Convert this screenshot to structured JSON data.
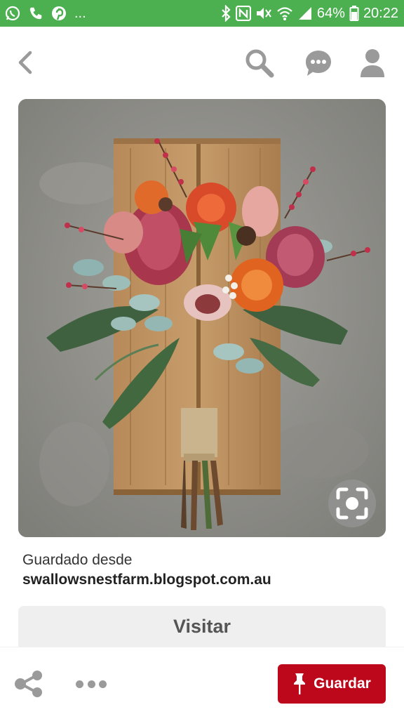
{
  "status_bar": {
    "battery": "64%",
    "time": "20:22",
    "ellipsis": "...",
    "left_icons": [
      "whatsapp-icon",
      "phone-icon",
      "pinterest-icon"
    ],
    "right_icons": [
      "bluetooth-icon",
      "nfc-icon",
      "mute-icon",
      "wifi-icon",
      "signal-icon",
      "battery-icon"
    ]
  },
  "nav": {
    "icons": [
      "back-icon",
      "search-icon",
      "chat-icon",
      "profile-icon"
    ]
  },
  "pin": {
    "image_icon": "visual-search-icon",
    "saved_from_label": "Guardado desde",
    "source_domain": "swallowsnestfarm.blogspot.com.au",
    "visit_label": "Visitar"
  },
  "bottom_bar": {
    "save_label": "Guardar",
    "icons": [
      "share-icon",
      "more-icon",
      "pin-icon"
    ]
  },
  "colors": {
    "status_bar": "#4caf50",
    "save_button": "#bd081c",
    "icon_gray": "#9a9a9a"
  }
}
